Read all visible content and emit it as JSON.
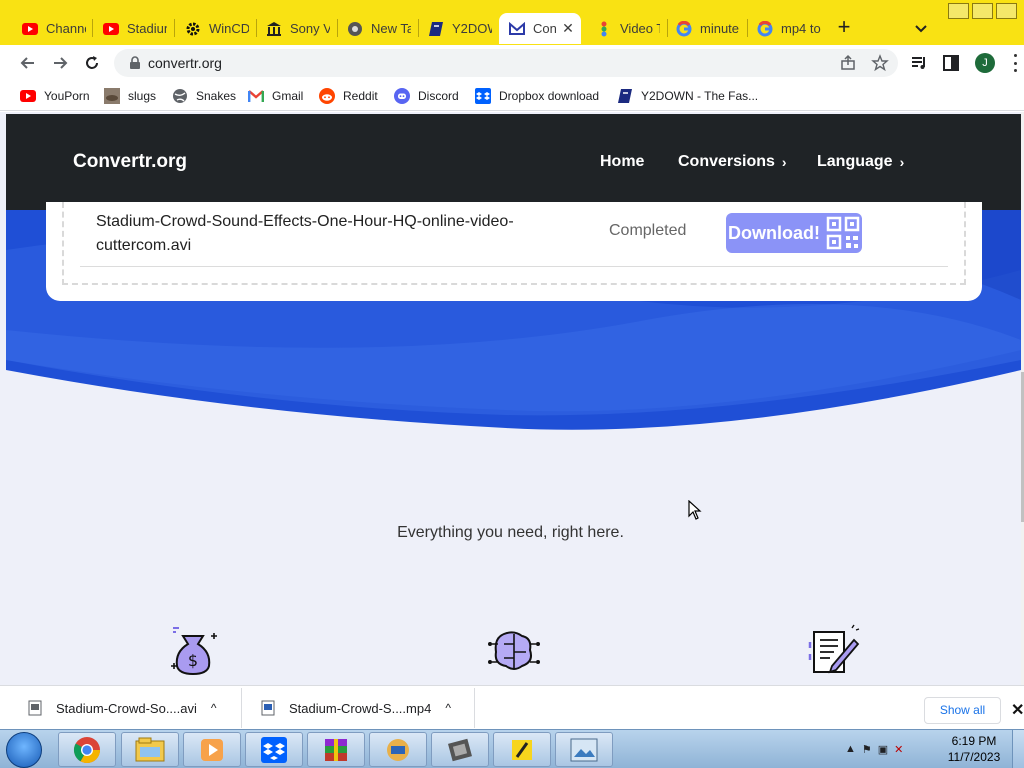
{
  "browser": {
    "tabs": [
      {
        "title": "Channe",
        "icon": "youtube-icon"
      },
      {
        "title": "Stadiun",
        "icon": "youtube-icon"
      },
      {
        "title": "WinCDI",
        "icon": "gear-icon"
      },
      {
        "title": "Sony Ve",
        "icon": "bank-icon"
      },
      {
        "title": "New Ta",
        "icon": "chrome-icon"
      },
      {
        "title": "Y2DOW",
        "icon": "y2down-icon"
      },
      {
        "title": "Con",
        "icon": "convertr-icon",
        "active": true
      },
      {
        "title": "Video T",
        "icon": "video-icon"
      },
      {
        "title": "minute:",
        "icon": "google-icon"
      },
      {
        "title": "mp4 to",
        "icon": "google-icon"
      }
    ],
    "new_tab": "+",
    "url": "convertr.org",
    "profile_initial": "J",
    "bookmarks": [
      {
        "label": "YouPorn",
        "icon": "youtube-icon"
      },
      {
        "label": "slugs",
        "icon": "slug-icon"
      },
      {
        "label": "Snakes",
        "icon": "globe-icon"
      },
      {
        "label": "Gmail",
        "icon": "gmail-icon"
      },
      {
        "label": "Reddit",
        "icon": "reddit-icon"
      },
      {
        "label": "Discord",
        "icon": "discord-icon"
      },
      {
        "label": "Dropbox download",
        "icon": "dropbox-icon"
      },
      {
        "label": "Y2DOWN - The Fas...",
        "icon": "y2down-icon"
      }
    ],
    "colors": {
      "tabstrip": "#f9e213",
      "accent": "#8b93f7",
      "nav": "#1f2326",
      "hero": "#1f4fd6"
    }
  },
  "site": {
    "logo": "Convertr.org",
    "nav": [
      {
        "label": "Home",
        "has_chevron": false
      },
      {
        "label": "Conversions",
        "has_chevron": true
      },
      {
        "label": "Language",
        "has_chevron": true
      }
    ],
    "chevron": "›",
    "file": {
      "name": "Stadium-Crowd-Sound-Effects-One-Hour-HQ-online-video-cuttercom.avi",
      "status": "Completed",
      "download_label": "Download!"
    },
    "tagline": "Everything you need, right here.",
    "features": [
      "money-bag-icon",
      "brain-circuit-icon",
      "document-edit-icon"
    ]
  },
  "downloads": {
    "items": [
      {
        "name": "Stadium-Crowd-So....avi"
      },
      {
        "name": "Stadium-Crowd-S....mp4"
      }
    ],
    "caret": "^",
    "show_all": "Show all",
    "close": "✕"
  },
  "taskbar": {
    "apps": [
      "chrome-icon",
      "explorer-icon",
      "media-player-icon",
      "dropbox-icon",
      "winrar-icon",
      "clipping-icon",
      "film-icon",
      "pencil-icon",
      "photo-icon"
    ],
    "time": "6:19 PM",
    "date": "11/7/2023"
  }
}
